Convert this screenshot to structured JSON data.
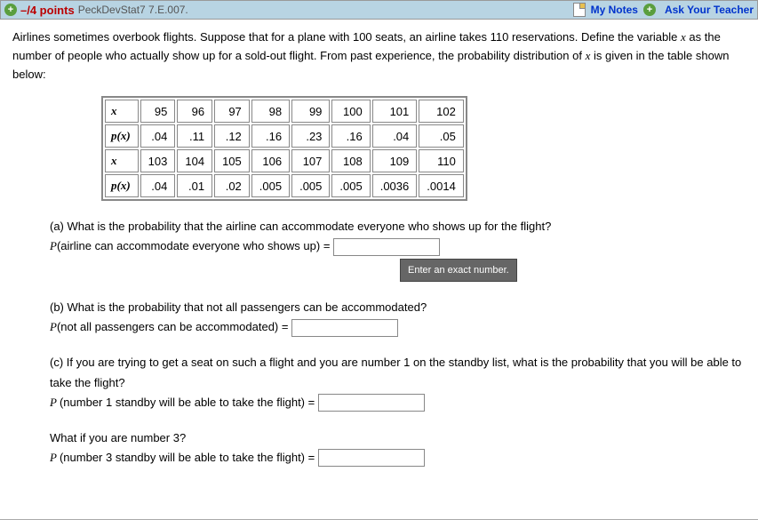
{
  "header": {
    "points_label": "–/4 points",
    "reference": "PeckDevStat7 7.E.007.",
    "my_notes": "My Notes",
    "ask_teacher": "Ask Your Teacher"
  },
  "problem": {
    "intro": "Airlines sometimes overbook flights. Suppose that for a plane with 100 seats, an airline takes 110 reservations. Define the variable ",
    "var": "x",
    "intro2": " as the number of people who actually show up for a sold-out flight. From past experience, the probability distribution of ",
    "intro3": " is given in the table shown below:"
  },
  "table": {
    "x_label": "x",
    "p_label": "p(x)",
    "row1_x": [
      "95",
      "96",
      "97",
      "98",
      "99",
      "100",
      "101",
      "102"
    ],
    "row1_p": [
      ".04",
      ".11",
      ".12",
      ".16",
      ".23",
      ".16",
      ".04",
      ".05"
    ],
    "row2_x": [
      "103",
      "104",
      "105",
      "106",
      "107",
      "108",
      "109",
      "110"
    ],
    "row2_p": [
      ".04",
      ".01",
      ".02",
      ".005",
      ".005",
      ".005",
      ".0036",
      ".0014"
    ]
  },
  "qa": {
    "a_text": "(a) What is the probability that the airline can accommodate everyone who shows up for the flight?",
    "a_prompt_pre": "P",
    "a_prompt": "(airline can accommodate everyone who shows up) = ",
    "tooltip": "Enter an exact number.",
    "b_text": "(b) What is the probability that not all passengers can be accommodated?",
    "b_prompt_pre": "P",
    "b_prompt": "(not all passengers can be accommodated) = ",
    "c_text": "(c) If you are trying to get a seat on such a flight and you are number 1 on the standby list, what is the probability that you will be able to take the flight?",
    "c_prompt_pre": "P ",
    "c_prompt": "(number 1 standby will be able to take the flight) = ",
    "c2_text": "What if you are number 3?",
    "c2_prompt_pre": "P ",
    "c2_prompt": "(number 3 standby will be able to take the flight) = "
  }
}
